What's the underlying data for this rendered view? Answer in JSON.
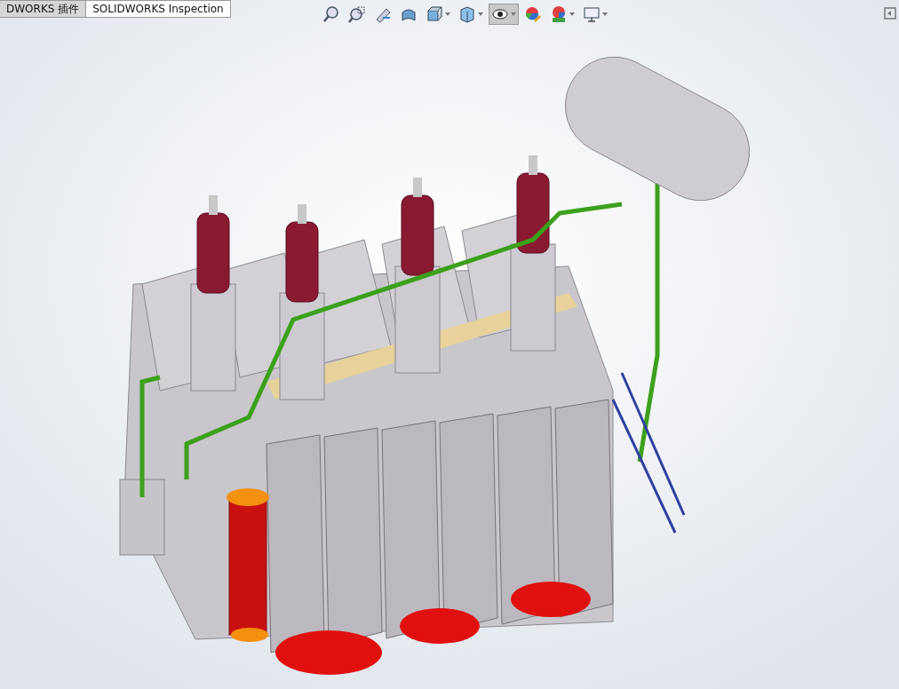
{
  "tabs": [
    {
      "label": "DWORKS 插件",
      "selected": false
    },
    {
      "label": "SOLIDWORKS Inspection",
      "selected": true
    }
  ],
  "toolbar": [
    {
      "kind": "zoom-fit",
      "dropdown": false,
      "pressed": false
    },
    {
      "kind": "zoom-area",
      "dropdown": false,
      "pressed": false
    },
    {
      "kind": "previous-view",
      "dropdown": false,
      "pressed": false
    },
    {
      "kind": "section-view",
      "dropdown": false,
      "pressed": false
    },
    {
      "kind": "view-orientation",
      "dropdown": true,
      "pressed": false
    },
    {
      "kind": "display-style",
      "dropdown": true,
      "pressed": false
    },
    {
      "kind": "hide-show",
      "dropdown": true,
      "pressed": true
    },
    {
      "kind": "edit-appearance",
      "dropdown": false,
      "pressed": false
    },
    {
      "kind": "scene",
      "dropdown": true,
      "pressed": false
    },
    {
      "kind": "view-settings",
      "dropdown": true,
      "pressed": false
    }
  ]
}
